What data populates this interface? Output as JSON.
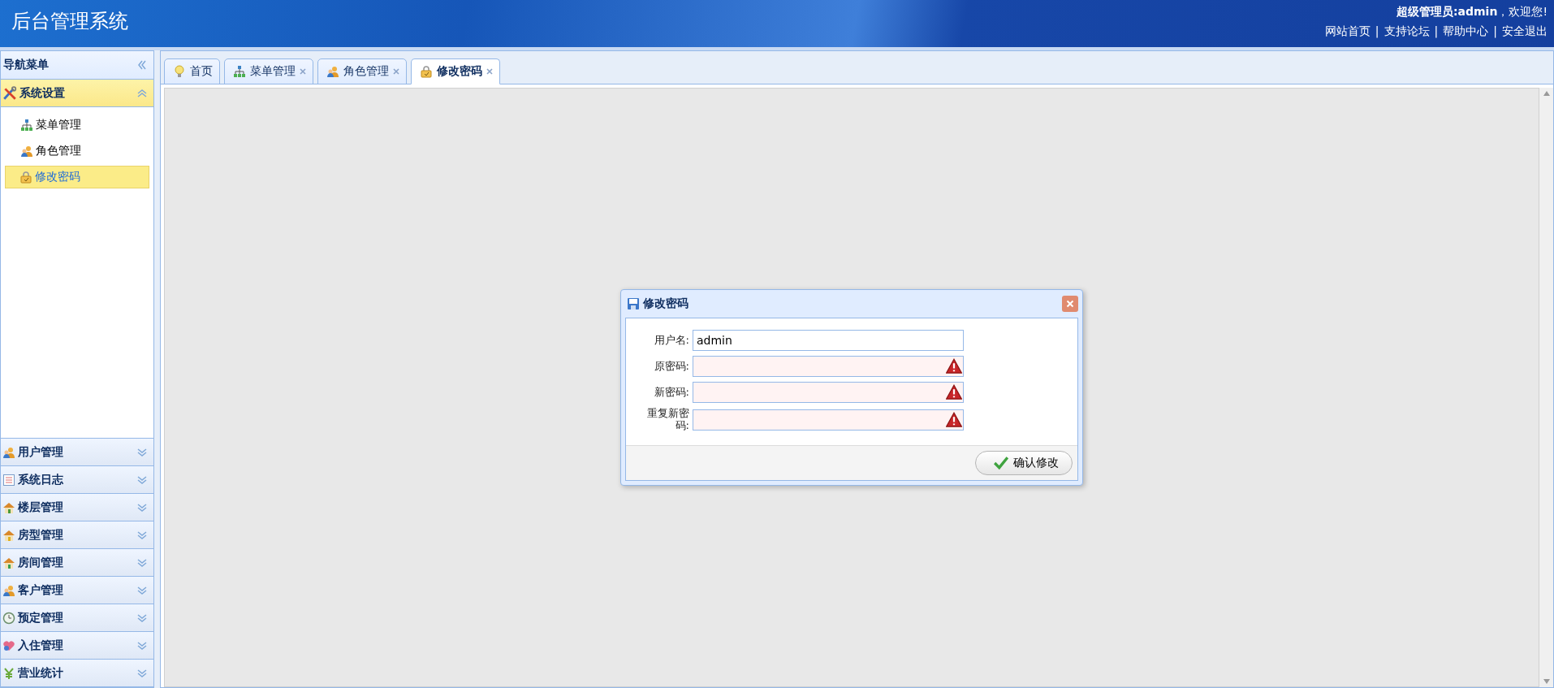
{
  "header": {
    "title": "后台管理系统",
    "welcome": "**超级管理员:admin**，欢迎您!",
    "links": [
      "网站首页",
      "支持论坛",
      "帮助中心",
      "安全退出"
    ],
    "separators": [
      "|",
      "|",
      "|"
    ]
  },
  "sidebar": {
    "title": "导航菜单",
    "groups": [
      {
        "label": "系统设置",
        "expanded": true,
        "items": [
          {
            "label": "菜单管理",
            "selected": false
          },
          {
            "label": "角色管理",
            "selected": false
          },
          {
            "label": "修改密码",
            "selected": true
          }
        ]
      },
      {
        "label": "用户管理",
        "expanded": false
      },
      {
        "label": "系统日志",
        "expanded": false
      },
      {
        "label": "楼层管理",
        "expanded": false
      },
      {
        "label": "房型管理",
        "expanded": false
      },
      {
        "label": "房间管理",
        "expanded": false
      },
      {
        "label": "客户管理",
        "expanded": false
      },
      {
        "label": "预定管理",
        "expanded": false
      },
      {
        "label": "入住管理",
        "expanded": false
      },
      {
        "label": "营业统计",
        "expanded": false
      }
    ]
  },
  "tabs": [
    {
      "label": "首页",
      "selected": false,
      "closable": false
    },
    {
      "label": "菜单管理",
      "selected": false,
      "closable": true
    },
    {
      "label": "角色管理",
      "selected": false,
      "closable": true
    },
    {
      "label": "修改密码",
      "selected": true,
      "closable": true
    }
  ],
  "dialog": {
    "title": "修改密码",
    "fields": [
      {
        "label": "用户名:",
        "value": "admin",
        "invalid": false
      },
      {
        "label": "原密码:",
        "invalid": true
      },
      {
        "label": "新密码:",
        "invalid": true
      },
      {
        "label": "重复新密码:",
        "invalid": true
      }
    ],
    "button": "确认修改"
  }
}
